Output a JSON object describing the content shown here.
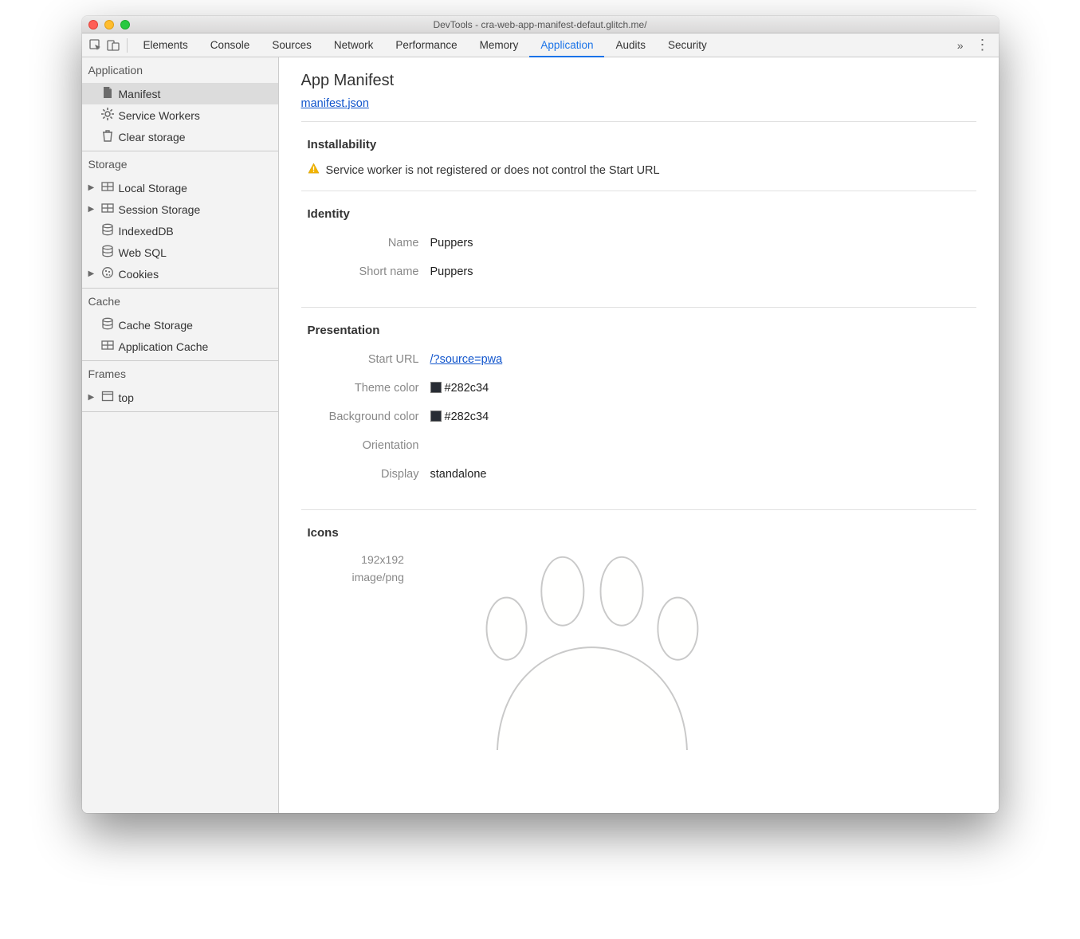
{
  "window_title": "DevTools - cra-web-app-manifest-defaut.glitch.me/",
  "tabs": [
    "Elements",
    "Console",
    "Sources",
    "Network",
    "Performance",
    "Memory",
    "Application",
    "Audits",
    "Security"
  ],
  "active_tab": "Application",
  "sidebar": {
    "groups": [
      {
        "title": "Application",
        "items": [
          {
            "label": "Manifest",
            "icon": "document-icon",
            "selected": true
          },
          {
            "label": "Service Workers",
            "icon": "gear-icon"
          },
          {
            "label": "Clear storage",
            "icon": "trash-icon"
          }
        ]
      },
      {
        "title": "Storage",
        "items": [
          {
            "label": "Local Storage",
            "icon": "table-icon",
            "expandable": true
          },
          {
            "label": "Session Storage",
            "icon": "table-icon",
            "expandable": true
          },
          {
            "label": "IndexedDB",
            "icon": "database-icon"
          },
          {
            "label": "Web SQL",
            "icon": "database-icon"
          },
          {
            "label": "Cookies",
            "icon": "cookie-icon",
            "expandable": true
          }
        ]
      },
      {
        "title": "Cache",
        "items": [
          {
            "label": "Cache Storage",
            "icon": "database-icon"
          },
          {
            "label": "Application Cache",
            "icon": "table-icon"
          }
        ]
      },
      {
        "title": "Frames",
        "items": [
          {
            "label": "top",
            "icon": "window-icon",
            "expandable": true
          }
        ]
      }
    ]
  },
  "manifest": {
    "heading": "App Manifest",
    "link": "manifest.json",
    "installability": {
      "title": "Installability",
      "warning": "Service worker is not registered or does not control the Start URL"
    },
    "identity": {
      "title": "Identity",
      "name_label": "Name",
      "name_value": "Puppers",
      "shortname_label": "Short name",
      "shortname_value": "Puppers"
    },
    "presentation": {
      "title": "Presentation",
      "starturl_label": "Start URL",
      "starturl_value": "/?source=pwa",
      "themecolor_label": "Theme color",
      "themecolor_value": "#282c34",
      "bgcolor_label": "Background color",
      "bgcolor_value": "#282c34",
      "orientation_label": "Orientation",
      "orientation_value": "",
      "display_label": "Display",
      "display_value": "standalone"
    },
    "icons": {
      "title": "Icons",
      "size": "192x192",
      "mime": "image/png"
    }
  }
}
